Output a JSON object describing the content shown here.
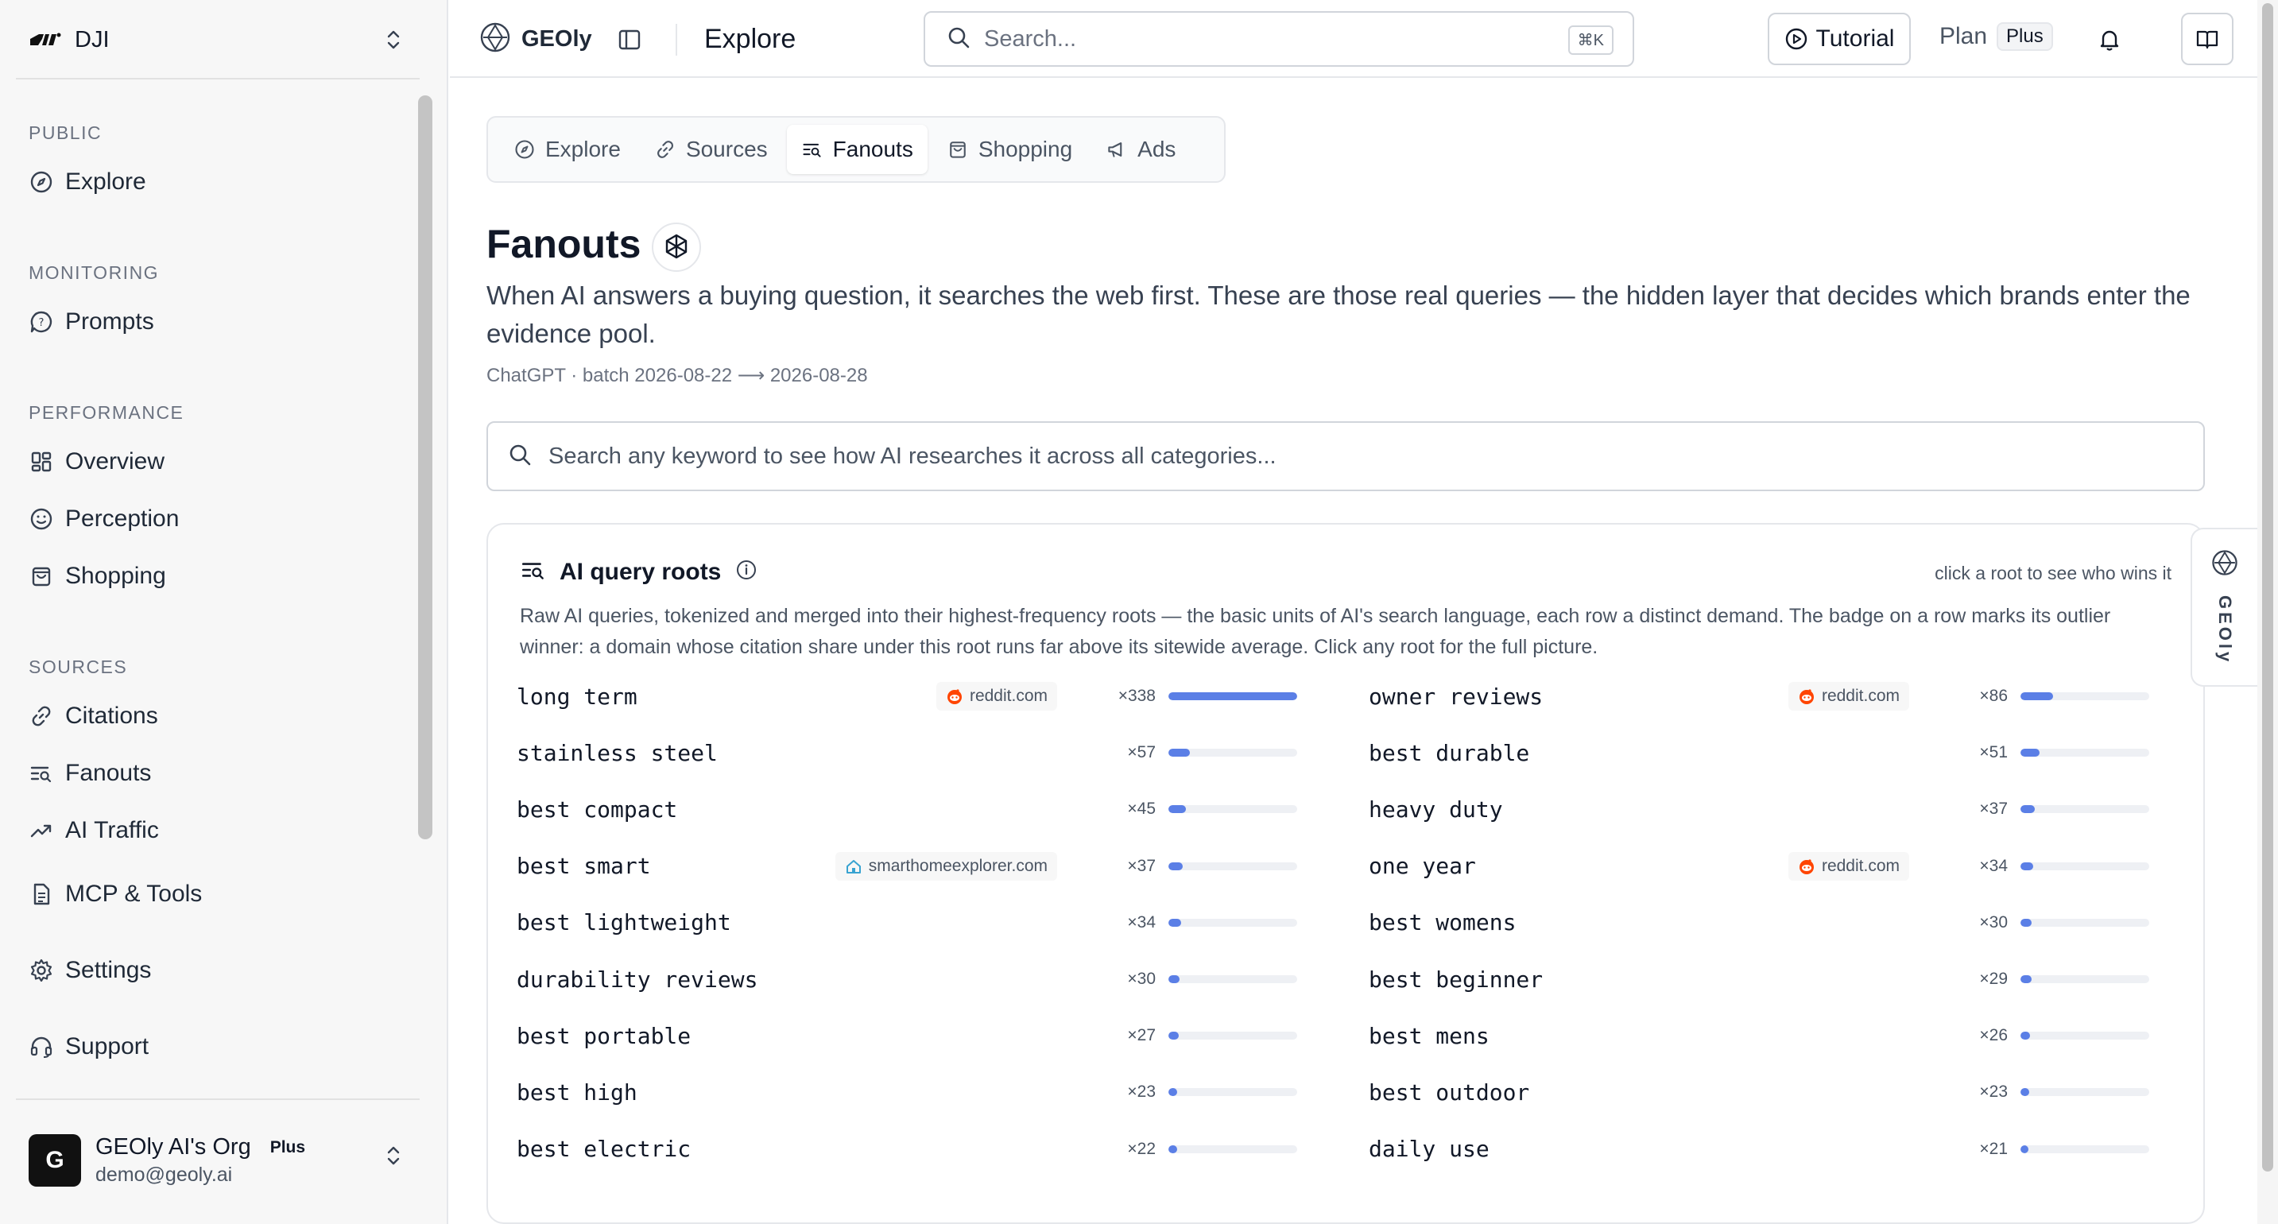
{
  "workspace": {
    "name": "DJI"
  },
  "sidebar": {
    "sections": [
      {
        "label": "PUBLIC",
        "items": [
          {
            "label": "Explore",
            "icon": "compass-icon"
          }
        ]
      },
      {
        "label": "MONITORING",
        "items": [
          {
            "label": "Prompts",
            "icon": "chat-bubble-icon"
          }
        ]
      },
      {
        "label": "PERFORMANCE",
        "items": [
          {
            "label": "Overview",
            "icon": "dashboard-grid-icon"
          },
          {
            "label": "Perception",
            "icon": "smile-icon"
          },
          {
            "label": "Shopping",
            "icon": "shopping-bag-icon"
          }
        ]
      },
      {
        "label": "SOURCES",
        "items": [
          {
            "label": "Citations",
            "icon": "link-icon"
          },
          {
            "label": "Fanouts",
            "icon": "fanout-list-icon"
          },
          {
            "label": "AI Traffic",
            "icon": "trend-up-icon"
          }
        ]
      }
    ],
    "extra": [
      {
        "label": "MCP & Tools",
        "icon": "document-icon"
      },
      {
        "label": "Settings",
        "icon": "gear-icon"
      },
      {
        "label": "Support",
        "icon": "headset-icon"
      }
    ],
    "user": {
      "initial": "G",
      "org": "GEOly AI's Org",
      "plan": "Plus",
      "email": "demo@geoly.ai"
    }
  },
  "topbar": {
    "brand": "GEOly",
    "page": "Explore",
    "search_placeholder": "Search...",
    "search_shortcut": "⌘K",
    "tutorial": "Tutorial",
    "plan_label": "Plan",
    "plan_badge": "Plus"
  },
  "tabs": [
    {
      "label": "Explore",
      "icon": "compass-icon",
      "active": false
    },
    {
      "label": "Sources",
      "icon": "link-icon",
      "active": false
    },
    {
      "label": "Fanouts",
      "icon": "fanout-list-icon",
      "active": true
    },
    {
      "label": "Shopping",
      "icon": "shopping-bag-icon",
      "active": false
    },
    {
      "label": "Ads",
      "icon": "megaphone-icon",
      "active": false
    }
  ],
  "page": {
    "title": "Fanouts",
    "description": "When AI answers a buying question, it searches the web first. These are those real queries — the hidden layer that decides which brands enter the evidence pool.",
    "batch": "ChatGPT · batch 2026-08-22 ⟶ 2026-08-28",
    "keyword_search_placeholder": "Search any keyword to see how AI researches it across all categories..."
  },
  "roots_card": {
    "title": "AI query roots",
    "hint": "click a root to see who wins it",
    "description": "Raw AI queries, tokenized and merged into their highest-frequency roots — the basic units of AI's search language, each row a distinct demand. The badge on a row marks its outlier winner: a domain whose citation share under this root runs far above its sitewide average. Click any root for the full picture.",
    "max_count": 338,
    "left": [
      {
        "term": "long term",
        "badge": "reddit.com",
        "badge_icon": "reddit",
        "count": "×338",
        "value": 338
      },
      {
        "term": "stainless steel",
        "badge": "",
        "badge_icon": "",
        "count": "×57",
        "value": 57
      },
      {
        "term": "best compact",
        "badge": "",
        "badge_icon": "",
        "count": "×45",
        "value": 45
      },
      {
        "term": "best smart",
        "badge": "smarthomeexplorer.com",
        "badge_icon": "house",
        "count": "×37",
        "value": 37
      },
      {
        "term": "best lightweight",
        "badge": "",
        "badge_icon": "",
        "count": "×34",
        "value": 34
      },
      {
        "term": "durability reviews",
        "badge": "",
        "badge_icon": "",
        "count": "×30",
        "value": 30
      },
      {
        "term": "best portable",
        "badge": "",
        "badge_icon": "",
        "count": "×27",
        "value": 27
      },
      {
        "term": "best high",
        "badge": "",
        "badge_icon": "",
        "count": "×23",
        "value": 23
      },
      {
        "term": "best electric",
        "badge": "",
        "badge_icon": "",
        "count": "×22",
        "value": 22
      }
    ],
    "right": [
      {
        "term": "owner reviews",
        "badge": "reddit.com",
        "badge_icon": "reddit",
        "count": "×86",
        "value": 86
      },
      {
        "term": "best durable",
        "badge": "",
        "badge_icon": "",
        "count": "×51",
        "value": 51
      },
      {
        "term": "heavy duty",
        "badge": "",
        "badge_icon": "",
        "count": "×37",
        "value": 37
      },
      {
        "term": "one year",
        "badge": "reddit.com",
        "badge_icon": "reddit",
        "count": "×34",
        "value": 34
      },
      {
        "term": "best womens",
        "badge": "",
        "badge_icon": "",
        "count": "×30",
        "value": 30
      },
      {
        "term": "best beginner",
        "badge": "",
        "badge_icon": "",
        "count": "×29",
        "value": 29
      },
      {
        "term": "best mens",
        "badge": "",
        "badge_icon": "",
        "count": "×26",
        "value": 26
      },
      {
        "term": "best outdoor",
        "badge": "",
        "badge_icon": "",
        "count": "×23",
        "value": 23
      },
      {
        "term": "daily use",
        "badge": "",
        "badge_icon": "",
        "count": "×21",
        "value": 21
      }
    ]
  },
  "side_widget": {
    "label": "GEOly"
  },
  "colors": {
    "bar_fill": "#5b7fe6",
    "bar_track": "#eef0f4",
    "reddit": "#ff4500",
    "house": "#38a3d1"
  }
}
